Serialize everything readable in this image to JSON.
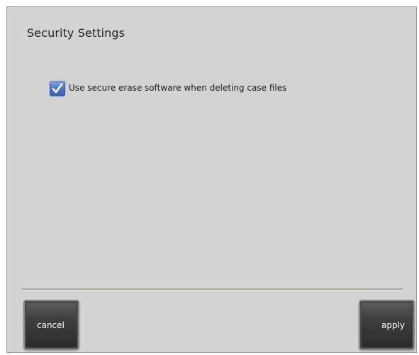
{
  "dialog": {
    "title": "Security Settings",
    "option": {
      "label": "Use secure erase software when deleting case files",
      "checked": true
    },
    "buttons": {
      "cancel": "cancel",
      "apply": "apply"
    }
  },
  "colors": {
    "panel": "#d3d3d3",
    "checkbox_accent": "#4a74c8",
    "button_dark": "#3e3e3e"
  }
}
